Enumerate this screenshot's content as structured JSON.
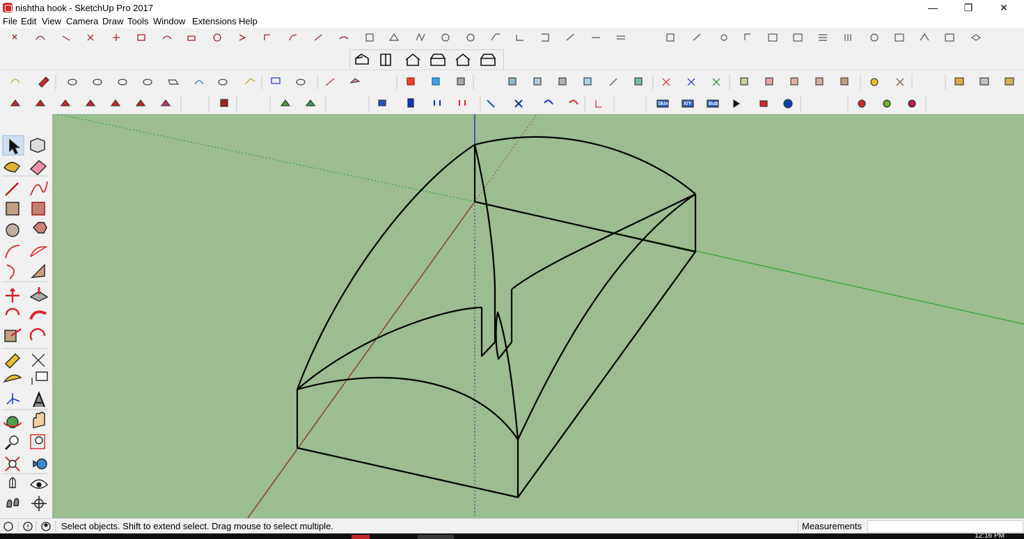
{
  "window": {
    "title": "nishtha hook - SketchUp Pro 2017",
    "minimize_glyph": "—",
    "maximize_glyph": "❐",
    "close_glyph": "✕"
  },
  "menu": [
    "File",
    "Edit",
    "View",
    "Camera",
    "Draw",
    "Tools",
    "Window",
    "Extensions",
    "Help"
  ],
  "status": {
    "hint": "Select objects. Shift to extend select. Drag mouse to select multiple.",
    "measurements_label": "Measurements",
    "measurements_value": ""
  },
  "taskbar": {
    "clock": "12:16 PM"
  },
  "colors": {
    "viewport": "#9bbd8f",
    "axis_blue": "#1c2fa8",
    "axis_red": "#8a2a10",
    "axis_green": "#18a018",
    "edges": "#000000",
    "accent": "#d7262b"
  },
  "toolbars": {
    "top_row_icons": [
      "rectangle-tool-icon",
      "arc-tool-icon",
      "line-tool-icon",
      "move-tool-icon",
      "rotate-tool-icon",
      "scale-tool-icon",
      "offset-tool-icon",
      "tape-tool-icon",
      "push-pull-icon",
      "paint-icon",
      "orbit-icon",
      "pan-icon",
      "zoom-icon",
      "zoom-extents-icon",
      "views-icon",
      "section-icon",
      "layers-icon"
    ],
    "house_icons": [
      "iso-view-icon",
      "top-view-icon",
      "front-view-icon",
      "right-view-icon",
      "back-view-icon",
      "left-view-icon"
    ],
    "left_tools": [
      "select-icon",
      "make-component-icon",
      "paint-bucket-icon",
      "eraser-icon",
      "pencil-icon",
      "freehand-icon",
      "rectangle-icon",
      "rotated-rectangle-icon",
      "circle-icon",
      "polygon-icon",
      "arc-icon",
      "pie-icon",
      "two-point-arc-icon",
      "three-point-arc-icon",
      "move-icon",
      "push-pull-icon",
      "rotate-icon",
      "follow-me-icon",
      "scale-icon",
      "offset-icon",
      "tape-measure-icon",
      "dimension-icon",
      "protractor-icon",
      "text-icon",
      "axes-icon",
      "3d-text-icon",
      "orbit-icon",
      "pan-icon",
      "zoom-icon",
      "zoom-window-icon",
      "zoom-extents-icon",
      "previous-view-icon",
      "position-camera-icon",
      "look-around-icon",
      "walk-icon",
      "section-plane-icon"
    ]
  }
}
